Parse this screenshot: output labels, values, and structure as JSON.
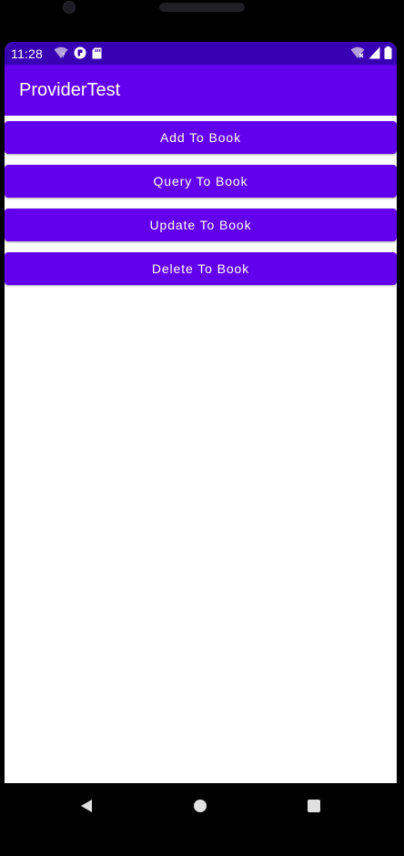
{
  "status_bar": {
    "time": "11:28",
    "left_icons": [
      "wifi-unknown-icon",
      "app-notification-icon",
      "sd-card-icon"
    ],
    "right_icons": [
      "wifi-off-icon",
      "cellular-signal-icon",
      "battery-icon"
    ]
  },
  "app_bar": {
    "title": "ProviderTest"
  },
  "buttons": [
    {
      "label": "Add To Book"
    },
    {
      "label": "Query To Book"
    },
    {
      "label": "Update To Book"
    },
    {
      "label": "Delete To Book"
    }
  ],
  "nav_bar": {
    "icons": [
      "back-icon",
      "home-icon",
      "recents-icon"
    ]
  },
  "colors": {
    "status_bar": "#3700b3",
    "primary": "#6200ee",
    "on_primary": "#ffffff",
    "background": "#ffffff"
  }
}
